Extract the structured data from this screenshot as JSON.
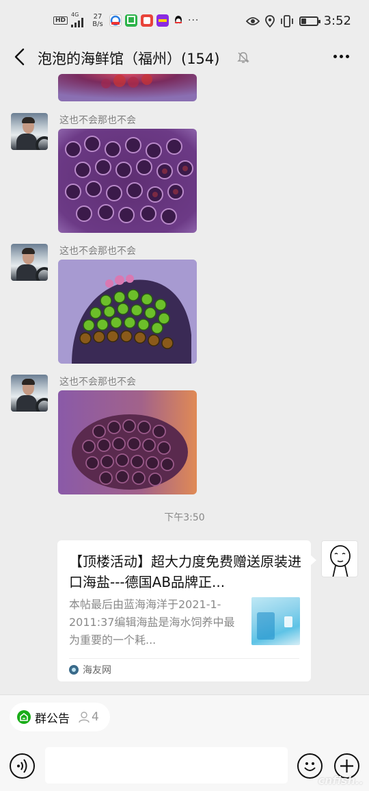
{
  "status_bar": {
    "hd": "HD",
    "network": "4G",
    "speed_value": "27",
    "speed_unit": "B/s",
    "more": "···",
    "time": "3:52",
    "battery_level": 0.3,
    "icons": [
      "eye-icon",
      "location-icon",
      "vibrate-icon",
      "battery-icon"
    ]
  },
  "header": {
    "title": "泡泡的海鲜馆（福州）(154)",
    "back_icon": "back-arrow-icon",
    "mute_icon": "mute-bell-icon",
    "more_icon": "more-icon"
  },
  "messages": [
    {
      "type": "image",
      "sender": "",
      "partial": true
    },
    {
      "type": "image",
      "sender": "这也不会那也不会"
    },
    {
      "type": "image",
      "sender": "这也不会那也不会"
    },
    {
      "type": "image",
      "sender": "这也不会那也不会"
    }
  ],
  "timestamp": "下午3:50",
  "link_card": {
    "title": "【顶楼活动】超大力度免费赠送原装进口海盐---德国AB品牌正...",
    "description": "本帖最后由蓝海海洋于2021-1-2011:37编辑海盐是海水饲养中最为重要的一个耗...",
    "source": "海友网"
  },
  "bottom": {
    "notice_label": "群公告",
    "notice_count": "4",
    "input_placeholder": "",
    "watermark": "cnfish.."
  },
  "colors": {
    "background": "#ededed",
    "green": "#1aad19",
    "sender_gray": "#808080"
  }
}
